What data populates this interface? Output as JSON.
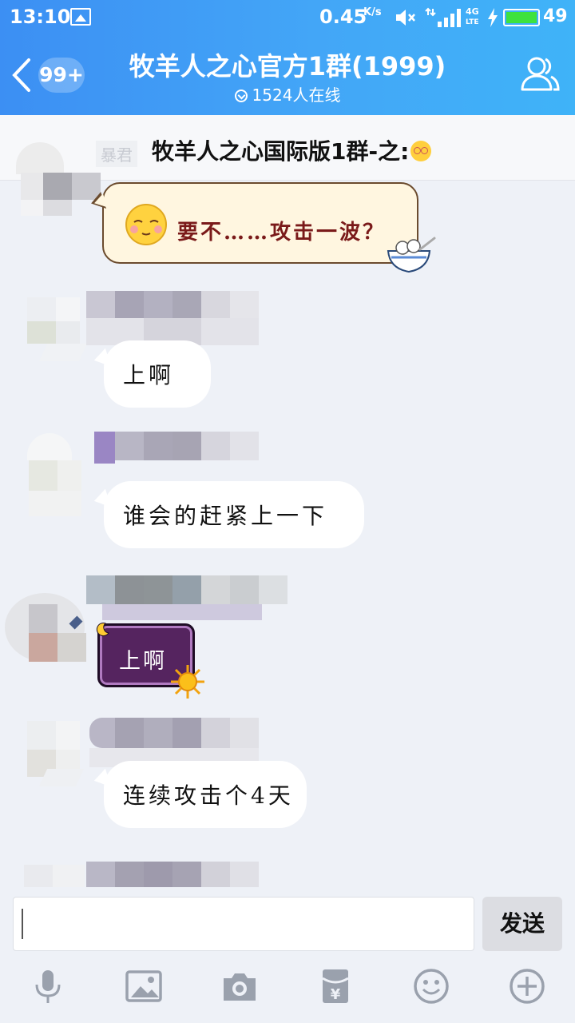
{
  "status_bar": {
    "time": "13:10",
    "speed": "0.45",
    "speed_unit": "K/s",
    "network": "4G",
    "network_sub": "LTE",
    "battery_level": "49",
    "battery_color": "#3ee23e"
  },
  "header": {
    "unread_count": "99+",
    "title": "牧羊人之心官方1群(1999)",
    "online": "1524人在线",
    "accent_gradient": [
      "#3c8ff3",
      "#3fb3f8"
    ]
  },
  "notice": {
    "ghost_name": "暴君",
    "text": "牧羊人之心国际版1群-之:"
  },
  "messages": [
    {
      "type": "sticker",
      "text": "要不……攻击一波？"
    },
    {
      "type": "text",
      "text": "上啊"
    },
    {
      "type": "text",
      "text": "谁会的赶紧上一下"
    },
    {
      "type": "styled",
      "text": "上啊"
    },
    {
      "type": "text",
      "text": "连续攻击个4天"
    }
  ],
  "input": {
    "send_label": "发送"
  },
  "toolbar": {
    "icons": [
      "microphone-icon",
      "image-icon",
      "camera-icon",
      "red-packet-icon",
      "emoji-icon",
      "plus-icon"
    ]
  }
}
